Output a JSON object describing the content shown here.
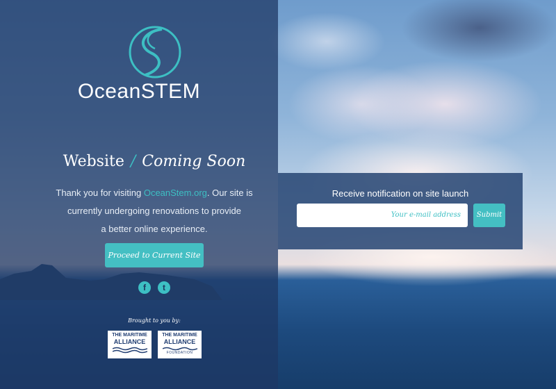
{
  "brand": {
    "name": "OceanSTEM",
    "accent_color": "#3dbfc3"
  },
  "headline": {
    "part1": "Website",
    "separator": "/",
    "part2": "Coming Soon"
  },
  "intro": {
    "line1_prefix": "Thank you for visiting ",
    "link_text": "OceanStem.org",
    "line1_suffix": ". Our site is",
    "line2": "currently undergoing renovations to provide",
    "line3": "a better online experience."
  },
  "proceed_button": {
    "label": "Proceed to Current Site"
  },
  "social": {
    "facebook_glyph": "f",
    "twitter_glyph": "t"
  },
  "sponsors": {
    "brought_by": "Brought to you by:",
    "items": [
      {
        "line1": "THE MARITIME",
        "line2": "ALLIANCE",
        "line3": ""
      },
      {
        "line1": "THE MARITIME",
        "line2": "ALLIANCE",
        "line3": "FOUNDATION"
      }
    ]
  },
  "notify": {
    "label": "Receive notification on site launch",
    "email_placeholder": "Your e-mail address",
    "submit_label": "Submit"
  }
}
